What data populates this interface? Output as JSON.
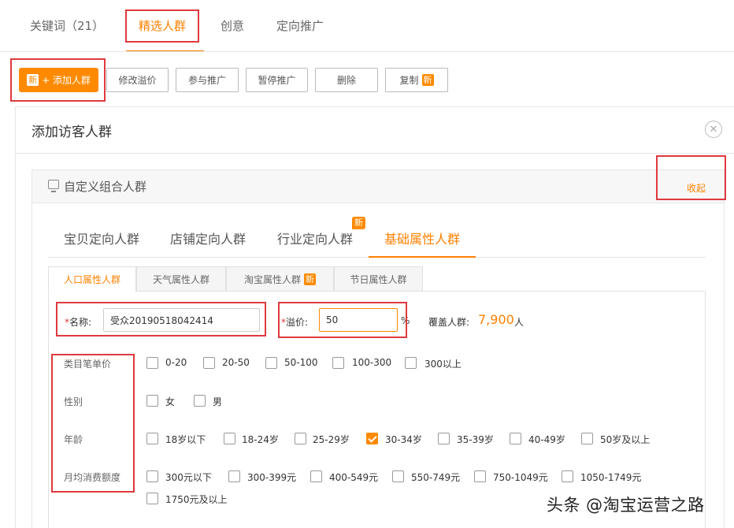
{
  "top_tabs": [
    "关键词（21）",
    "精选人群",
    "创意",
    "定向推广"
  ],
  "toolbar": {
    "add_badge": "新",
    "add_label": "+ 添加人群",
    "modify_premium": "修改溢价",
    "join_promotion": "参与推广",
    "pause_promotion": "暂停推广",
    "delete": "删除",
    "copy": "复制",
    "copy_badge": "新"
  },
  "panel": {
    "title": "添加访客人群",
    "close_icon": "close-circle-icon"
  },
  "group": {
    "title": "自定义组合人群",
    "collapse": "收起"
  },
  "sub_tabs": [
    "宝贝定向人群",
    "店铺定向人群",
    "行业定向人群",
    "基础属性人群"
  ],
  "sub_tab_badge": "新",
  "attr_tabs": [
    "人口属性人群",
    "天气属性人群",
    "淘宝属性人群",
    "节日属性人群"
  ],
  "attr_tab_badge": "新",
  "form": {
    "name_required": "*",
    "name_label": "名称:",
    "name_value": "受众20190518042414",
    "premium_required": "*",
    "premium_label": "溢价:",
    "premium_value": "50",
    "premium_unit": "%",
    "coverage_label": "覆盖人群:",
    "coverage_value": "7,900",
    "coverage_unit": "人"
  },
  "attributes": {
    "price": {
      "label": "类目笔单价",
      "options": [
        "0-20",
        "20-50",
        "50-100",
        "100-300",
        "300以上"
      ]
    },
    "gender": {
      "label": "性别",
      "options": [
        "女",
        "男"
      ]
    },
    "age": {
      "label": "年龄",
      "options": [
        "18岁以下",
        "18-24岁",
        "25-29岁",
        "30-34岁",
        "35-39岁",
        "40-49岁",
        "50岁及以上"
      ],
      "checked": "30-34岁"
    },
    "spend": {
      "label": "月均消费额度",
      "options": [
        "300元以下",
        "300-399元",
        "400-549元",
        "550-749元",
        "750-1049元",
        "1050-1749元",
        "1750元及以上"
      ]
    }
  },
  "watermark": "头条 @淘宝运营之路",
  "colors": {
    "accent": "#ff8a00",
    "highlight_box": "#e0393e"
  }
}
